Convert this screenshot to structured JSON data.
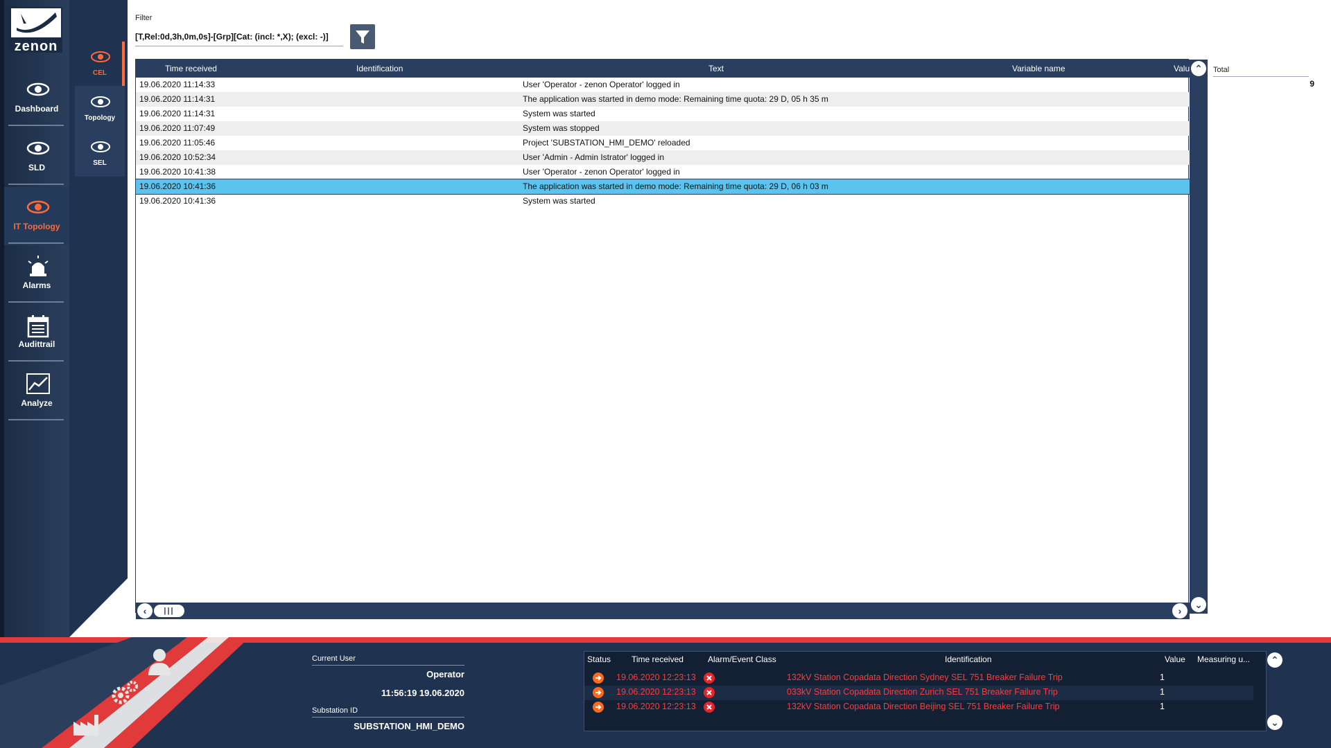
{
  "app": {
    "logo_text": "zenon"
  },
  "nav": {
    "items": [
      {
        "label": "Dashboard",
        "icon": "eye-icon"
      },
      {
        "label": "SLD",
        "icon": "eye-icon"
      },
      {
        "label": "IT Topology",
        "icon": "eye-icon",
        "active": true
      },
      {
        "label": "Alarms",
        "icon": "alarm-light-icon"
      },
      {
        "label": "Audittrail",
        "icon": "calendar-icon"
      },
      {
        "label": "Analyze",
        "icon": "chart-icon"
      }
    ]
  },
  "subnav": {
    "items": [
      {
        "label": "CEL",
        "active": true
      },
      {
        "label": "Topology"
      },
      {
        "label": "SEL"
      }
    ]
  },
  "filter": {
    "label": "Filter",
    "value": "[T,Rel:0d,3h,0m,0s]-[Grp][Cat: (incl: *,X); (excl: -)]"
  },
  "table": {
    "columns": {
      "time": "Time received",
      "identification": "Identification",
      "text": "Text",
      "variable": "Variable name",
      "value": "Valu"
    },
    "rows": [
      {
        "time": "19.06.2020 11:14:33",
        "text": "User 'Operator - zenon Operator' logged in"
      },
      {
        "time": "19.06.2020 11:14:31",
        "text": "The application was started in demo mode: Remaining time quota: 29 D, 05 h 35 m"
      },
      {
        "time": "19.06.2020 11:14:31",
        "text": "System was started"
      },
      {
        "time": "19.06.2020 11:07:49",
        "text": "System was stopped"
      },
      {
        "time": "19.06.2020 11:05:46",
        "text": "Project 'SUBSTATION_HMI_DEMO' reloaded"
      },
      {
        "time": "19.06.2020 10:52:34",
        "text": "User 'Admin - Admin Istrator' logged in"
      },
      {
        "time": "19.06.2020 10:41:38",
        "text": "User 'Operator - zenon Operator' logged in"
      },
      {
        "time": "19.06.2020 10:41:36",
        "text": "The application was started in demo mode: Remaining time quota: 29 D, 06 h 03 m",
        "selected": true
      },
      {
        "time": "19.06.2020 10:41:36",
        "text": "System was started"
      }
    ]
  },
  "total": {
    "label": "Total",
    "value": "9"
  },
  "footer": {
    "current_user_label": "Current User",
    "current_user": "Operator",
    "datetime": "11:56:19 19.06.2020",
    "substation_label": "Substation ID",
    "substation": "SUBSTATION_HMI_DEMO"
  },
  "alarms": {
    "columns": {
      "status": "Status",
      "time": "Time received",
      "class": "Alarm/Event Class",
      "identification": "Identification",
      "value": "Value",
      "measuring": "Measuring u..."
    },
    "rows": [
      {
        "time": "19.06.2020 12:23:13",
        "identification": "132kV Station Copadata Direction Sydney SEL 751 Breaker Failure Trip",
        "value": "1"
      },
      {
        "time": "19.06.2020 12:23:13",
        "identification": "033kV Station Copadata Direction Zurich SEL 751 Breaker Failure Trip",
        "value": "1"
      },
      {
        "time": "19.06.2020 12:23:13",
        "identification": "132kV Station Copadata Direction Beijing SEL 751 Breaker Failure Trip",
        "value": "1"
      }
    ]
  },
  "colors": {
    "accent": "#ff6a3d",
    "navy": "#1f3250",
    "header": "#2a3f5f",
    "selection": "#5bc4ee",
    "alarm_text": "#ff3b3b",
    "red_band": "#e03a3a"
  }
}
